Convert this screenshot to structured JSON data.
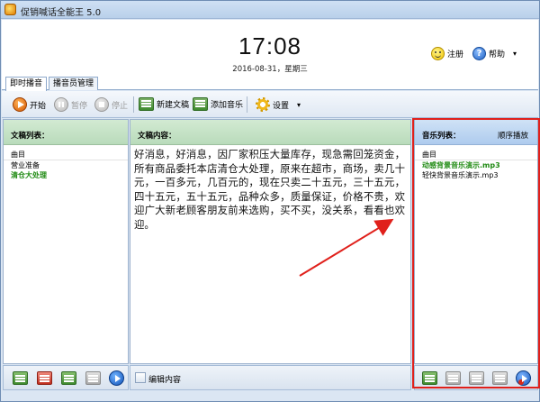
{
  "window": {
    "title": "促销喊话全能王 5.0"
  },
  "header": {
    "time": "17:08",
    "date": "2016-08-31，星期三",
    "register_label": "注册",
    "help_label": "帮助",
    "help_caret": "▾"
  },
  "tabs": [
    {
      "label": "即时播音"
    },
    {
      "label": "播音员管理"
    }
  ],
  "toolbar": {
    "start_label": "开始",
    "pause_label": "暂停",
    "stop_label": "停止",
    "new_script_label": "新建文稿",
    "add_music_label": "添加音乐",
    "settings_label": "设置",
    "settings_caret": "▾"
  },
  "script_list": {
    "title": "文稿列表：",
    "column": "曲目",
    "items": [
      {
        "label": "营业准备"
      },
      {
        "label": "清仓大处理"
      }
    ]
  },
  "script_content": {
    "title": "文稿内容：",
    "text": "好消息，好消息，因厂家积压大量库存，现急需回笼资金，所有商品委托本店清仓大处理，原来在超市，商场，卖几十元，一百多元，几百元的，现在只卖二十五元，三十五元，四十五元，五十五元，品种众多，质量保证，价格不贵，欢迎广大新老顾客朋友前来选购，买不买，没关系，看看也欢迎。"
  },
  "music_list": {
    "title": "音乐列表：",
    "mode": "顺序播放",
    "column": "曲目",
    "items": [
      {
        "label": "动感背景音乐演示.mp3"
      },
      {
        "label": "轻快背景音乐演示.mp3"
      }
    ]
  },
  "bottom": {
    "edit_label": "编辑内容"
  },
  "colors": {
    "highlight_box": "#e0201b",
    "active_item": "#1f8a12",
    "panel_head_green": "#b9dbbb",
    "panel_head_blue": "#aecbee"
  }
}
